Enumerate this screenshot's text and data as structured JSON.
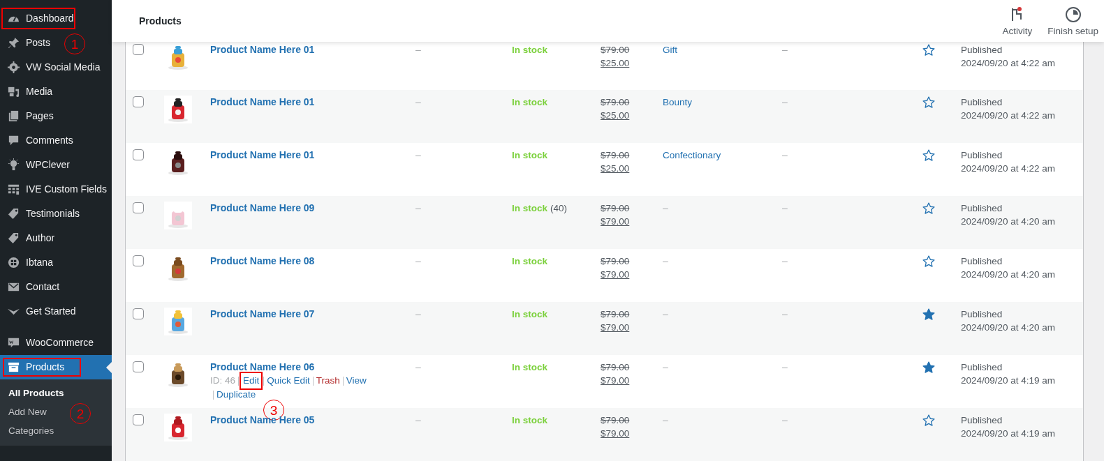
{
  "sidebar": {
    "items": [
      {
        "label": "Dashboard",
        "selected": false,
        "boxed": true
      },
      {
        "label": "Posts",
        "selected": false,
        "boxed": false,
        "callout": "1"
      },
      {
        "label": "VW Social Media",
        "selected": false,
        "boxed": false
      },
      {
        "label": "Media",
        "selected": false,
        "boxed": false
      },
      {
        "label": "Pages",
        "selected": false,
        "boxed": false
      },
      {
        "label": "Comments",
        "selected": false,
        "boxed": false
      },
      {
        "label": "WPClever",
        "selected": false,
        "boxed": false
      },
      {
        "label": "IVE Custom Fields",
        "selected": false,
        "boxed": false
      },
      {
        "label": "Testimonials",
        "selected": false,
        "boxed": false
      },
      {
        "label": "Author",
        "selected": false,
        "boxed": false
      },
      {
        "label": "Ibtana",
        "selected": false,
        "boxed": false
      },
      {
        "label": "Contact",
        "selected": false,
        "boxed": false
      },
      {
        "label": "Get Started",
        "selected": false,
        "boxed": false
      }
    ],
    "store_items": [
      {
        "label": "WooCommerce",
        "selected": false,
        "boxed": false
      },
      {
        "label": "Products",
        "selected": true,
        "boxed": true
      }
    ],
    "submenu": [
      {
        "label": "All Products",
        "selected": true
      },
      {
        "label": "Add New",
        "selected": false,
        "callout": "2"
      },
      {
        "label": "Categories",
        "selected": false
      }
    ]
  },
  "header": {
    "title": "Products",
    "actions": [
      {
        "label": "Activity",
        "badge": true
      },
      {
        "label": "Finish setup",
        "badge": false
      }
    ]
  },
  "rows": [
    {
      "checked": false,
      "name": "Product Name Here 01",
      "sku": "–",
      "stock": "In stock",
      "regular_price": "$79.00",
      "sale_price": "$25.00",
      "categories": "Gift",
      "tags": "–",
      "featured": false,
      "status": "Published",
      "date": "2024/09/20 at 4:22 am"
    },
    {
      "checked": false,
      "name": "Product Name Here 01",
      "sku": "–",
      "stock": "In stock",
      "regular_price": "$79.00",
      "sale_price": "$25.00",
      "categories": "Bounty",
      "tags": "–",
      "featured": false,
      "status": "Published",
      "date": "2024/09/20 at 4:22 am"
    },
    {
      "checked": false,
      "name": "Product Name Here 01",
      "sku": "–",
      "stock": "In stock",
      "regular_price": "$79.00",
      "sale_price": "$25.00",
      "categories": "Confectionary",
      "tags": "–",
      "featured": false,
      "status": "Published",
      "date": "2024/09/20 at 4:22 am"
    },
    {
      "checked": false,
      "name": "Product Name Here 09",
      "sku": "–",
      "stock": "In stock",
      "stock_count": "(40)",
      "regular_price": "$79.00",
      "sale_price": "$79.00",
      "categories": "–",
      "tags": "–",
      "featured": false,
      "status": "Published",
      "date": "2024/09/20 at 4:20 am"
    },
    {
      "checked": false,
      "name": "Product Name Here 08",
      "sku": "–",
      "stock": "In stock",
      "regular_price": "$79.00",
      "sale_price": "$79.00",
      "categories": "–",
      "tags": "–",
      "featured": false,
      "status": "Published",
      "date": "2024/09/20 at 4:20 am"
    },
    {
      "checked": false,
      "name": "Product Name Here 07",
      "sku": "–",
      "stock": "In stock",
      "regular_price": "$79.00",
      "sale_price": "$79.00",
      "categories": "–",
      "tags": "–",
      "featured": true,
      "status": "Published",
      "date": "2024/09/20 at 4:20 am"
    },
    {
      "checked": false,
      "name": "Product Name Here 06",
      "sku": "–",
      "stock": "In stock",
      "regular_price": "$79.00",
      "sale_price": "$79.00",
      "categories": "–",
      "tags": "–",
      "featured": true,
      "status": "Published",
      "date": "2024/09/20 at 4:19 am",
      "callout": "3",
      "actions": [
        {
          "kind": "id",
          "label": "ID: 46"
        },
        {
          "kind": "link",
          "label": "Edit",
          "boxed": true
        },
        {
          "kind": "link",
          "label": "Quick Edit",
          "boxed": false
        },
        {
          "kind": "trash",
          "label": "Trash",
          "boxed": false
        },
        {
          "kind": "link",
          "label": "View",
          "boxed": false
        },
        {
          "kind": "link",
          "label": "Duplicate",
          "boxed": false
        }
      ]
    },
    {
      "checked": false,
      "name": "Product Name Here 05",
      "sku": "–",
      "stock": "In stock",
      "regular_price": "$79.00",
      "sale_price": "$79.00",
      "categories": "–",
      "tags": "–",
      "featured": false,
      "status": "Published",
      "date": "2024/09/20 at 4:19 am"
    }
  ]
}
